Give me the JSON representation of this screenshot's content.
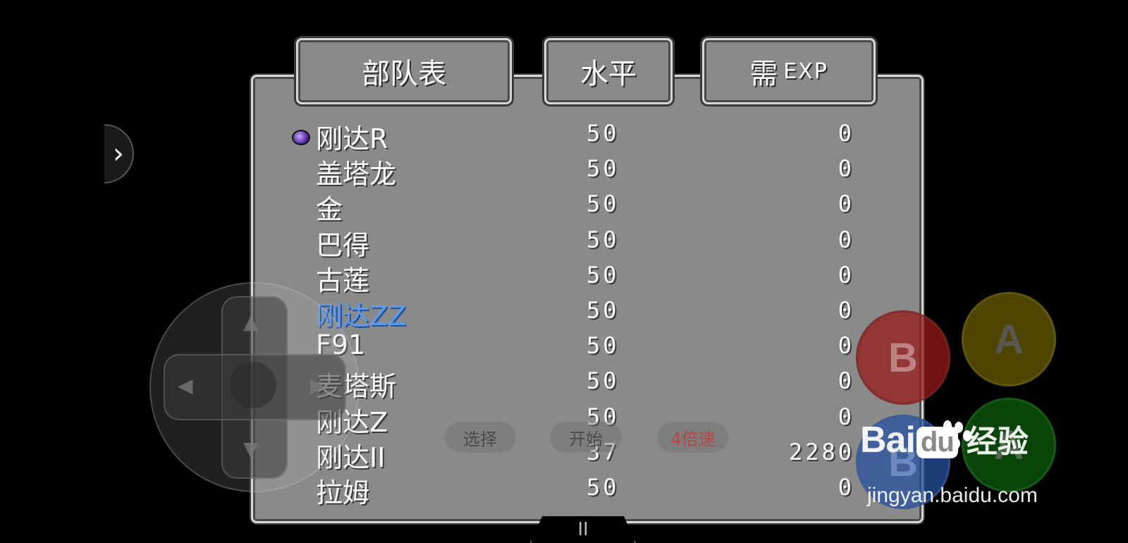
{
  "header": {
    "tab_roster": "部队表",
    "tab_level": "水平",
    "tab_exp_prefix": "需",
    "tab_exp_suffix": "EXP"
  },
  "roster": [
    {
      "name": "刚达R",
      "level": "50",
      "exp": "0",
      "highlight": false
    },
    {
      "name": "盖塔龙",
      "level": "50",
      "exp": "0",
      "highlight": false
    },
    {
      "name": "金",
      "level": "50",
      "exp": "0",
      "highlight": false
    },
    {
      "name": "巴得",
      "level": "50",
      "exp": "0",
      "highlight": false
    },
    {
      "name": "古莲",
      "level": "50",
      "exp": "0",
      "highlight": false
    },
    {
      "name": "刚达ZZ",
      "level": "50",
      "exp": "0",
      "highlight": true
    },
    {
      "name": "F91",
      "level": "50",
      "exp": "0",
      "highlight": false
    },
    {
      "name": "麦塔斯",
      "level": "50",
      "exp": "0",
      "highlight": false
    },
    {
      "name": "刚达Z",
      "level": "50",
      "exp": "0",
      "highlight": false
    },
    {
      "name": "刚达II",
      "level": "37",
      "exp": "2280",
      "highlight": false
    },
    {
      "name": "拉姆",
      "level": "50",
      "exp": "0",
      "highlight": false
    }
  ],
  "controls": {
    "select_label": "选择",
    "start_label": "开始",
    "turbo_label": "4倍速",
    "btn_b": "B",
    "btn_a": "A",
    "btn_b_turbo": "B",
    "btn_a_turbo": "A",
    "pause_label": "II",
    "side_arrow": "›",
    "dpad_up": "▲",
    "dpad_down": "▼",
    "dpad_left": "◀",
    "dpad_right": "▶"
  },
  "watermark": {
    "brand_a": "Bai",
    "brand_b": "du",
    "brand_cn": "经验",
    "url": "jingyan.baidu.com"
  },
  "colors": {
    "panel": "#8a8a8a",
    "highlight_text": "#5b9cf3"
  }
}
